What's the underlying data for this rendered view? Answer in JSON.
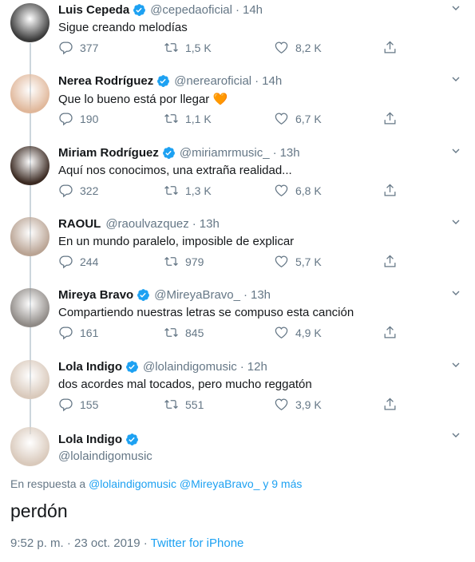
{
  "tweets": [
    {
      "name": "Luis Cepeda",
      "verified": true,
      "handle": "@cepedaoficial",
      "time": "14h",
      "text": "Sigue creando melodías",
      "replies": "377",
      "retweets": "1,5 K",
      "likes": "8,2 K",
      "avatar_color": "#3a3a3a"
    },
    {
      "name": "Nerea Rodríguez",
      "verified": true,
      "handle": "@nerearoficial",
      "time": "14h",
      "text": "Que lo bueno está por llegar 🧡",
      "replies": "190",
      "retweets": "1,1 K",
      "likes": "6,7 K",
      "avatar_color": "#e0b79a"
    },
    {
      "name": "Miriam Rodríguez",
      "verified": true,
      "handle": "@miriamrmusic_",
      "time": "13h",
      "text": "Aquí nos conocimos, una extraña realidad...",
      "replies": "322",
      "retweets": "1,3 K",
      "likes": "6,8 K",
      "avatar_color": "#3b2a22"
    },
    {
      "name": "RAOUL",
      "verified": false,
      "handle": "@raoulvazquez",
      "time": "13h",
      "text": "En un mundo paralelo, imposible de explicar",
      "replies": "244",
      "retweets": "979",
      "likes": "5,7 K",
      "avatar_color": "#b9a393"
    },
    {
      "name": "Mireya Bravo",
      "verified": true,
      "handle": "@MireyaBravo_",
      "time": "13h",
      "text": "Compartiendo nuestras letras se compuso esta canción",
      "replies": "161",
      "retweets": "845",
      "likes": "4,9 K",
      "avatar_color": "#8f8a86"
    },
    {
      "name": "Lola Indigo",
      "verified": true,
      "handle": "@lolaindigomusic",
      "time": "12h",
      "text": "dos acordes mal tocados, pero mucho reggatón",
      "replies": "155",
      "retweets": "551",
      "likes": "3,9 K",
      "avatar_color": "#d9c9bb"
    }
  ],
  "focus": {
    "name": "Lola Indigo",
    "handle": "@lolaindigomusic",
    "avatar_color": "#d9c9bb",
    "reply_prefix": "En respuesta a",
    "reply_user1": "@lolaindigomusic",
    "reply_user2": "@MireyaBravo_",
    "reply_more": "y 9 más",
    "text": "perdón",
    "timestamp": "9:52 p. m. · 23 oct. 2019 · ",
    "source": "Twitter for iPhone"
  },
  "colors": {
    "accent": "#1da1f2",
    "muted": "#657786",
    "line": "#ccd6dd"
  }
}
